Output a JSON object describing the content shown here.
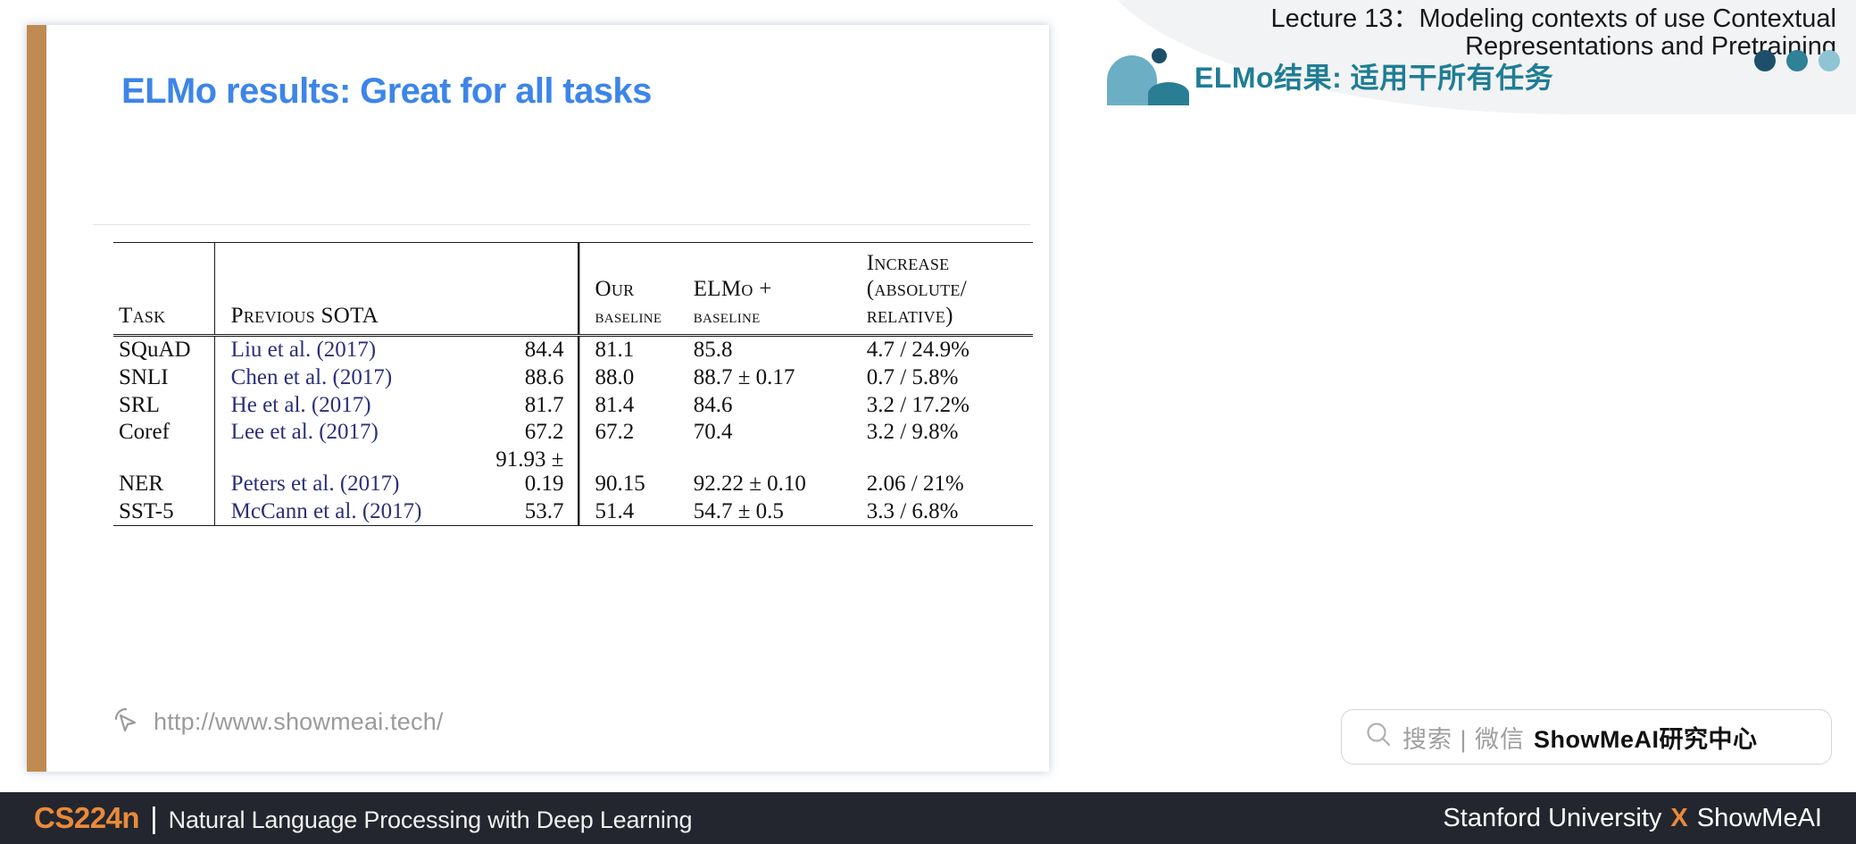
{
  "header": {
    "lecture_title": "Lecture 13：Modeling contexts of use Contextual\nRepresentations and Pretraining",
    "cn_subtitle": "ELMo结果: 适用干所有任务",
    "dots": [
      "#1d4f6b",
      "#2e8196",
      "#8fc4d4"
    ]
  },
  "slide": {
    "title": "ELMo results: Great for all tasks",
    "accent_color": "#c08a53",
    "title_color": "#3d85e8",
    "watermark": "http://www.showmeai.tech/",
    "watermark_icon": "cursor-arrow-icon"
  },
  "table": {
    "headers": {
      "task": "Task",
      "previous_sota": "Previous SOTA",
      "previous_sota_value": "",
      "our_line1": "Our",
      "our_line2": "baseline",
      "elmo_line1": "ELMo +",
      "elmo_line2": "baseline",
      "increase_line1": "Increase",
      "increase_line2": "(absolute/",
      "increase_line3": "relative)"
    },
    "rows": [
      {
        "task": "SQuAD",
        "sota_cite": "Liu et al. (2017)",
        "sota_value": "84.4",
        "our_baseline": "81.1",
        "elmo_baseline": "85.8",
        "increase": "4.7 / 24.9%"
      },
      {
        "task": "SNLI",
        "sota_cite": "Chen et al. (2017)",
        "sota_value": "88.6",
        "our_baseline": "88.0",
        "elmo_baseline": "88.7 ± 0.17",
        "increase": "0.7 / 5.8%"
      },
      {
        "task": "SRL",
        "sota_cite": "He et al. (2017)",
        "sota_value": "81.7",
        "our_baseline": "81.4",
        "elmo_baseline": "84.6",
        "increase": "3.2 / 17.2%"
      },
      {
        "task": "Coref",
        "sota_cite": "Lee et al. (2017)",
        "sota_value": "67.2",
        "our_baseline": "67.2",
        "elmo_baseline": "70.4",
        "increase": "3.2 / 9.8%"
      },
      {
        "task": "NER",
        "sota_cite": "Peters et al. (2017)",
        "sota_value": "91.93 ± 0.19",
        "our_baseline": "90.15",
        "elmo_baseline": "92.22 ± 0.10",
        "increase": "2.06 / 21%"
      },
      {
        "task": "SST-5",
        "sota_cite": "McCann et al. (2017)",
        "sota_value": "53.7",
        "our_baseline": "51.4",
        "elmo_baseline": "54.7 ± 0.5",
        "increase": "3.3 / 6.8%"
      }
    ]
  },
  "search": {
    "icon": "search-icon",
    "placeholder": "搜索 | 微信",
    "brand": "ShowMeAI研究中心"
  },
  "footer": {
    "course": "CS224n",
    "separator": "|",
    "subtitle": "Natural Language Processing with Deep Learning",
    "right_left": "Stanford University",
    "right_x": "X",
    "right_right": "ShowMeAI"
  }
}
